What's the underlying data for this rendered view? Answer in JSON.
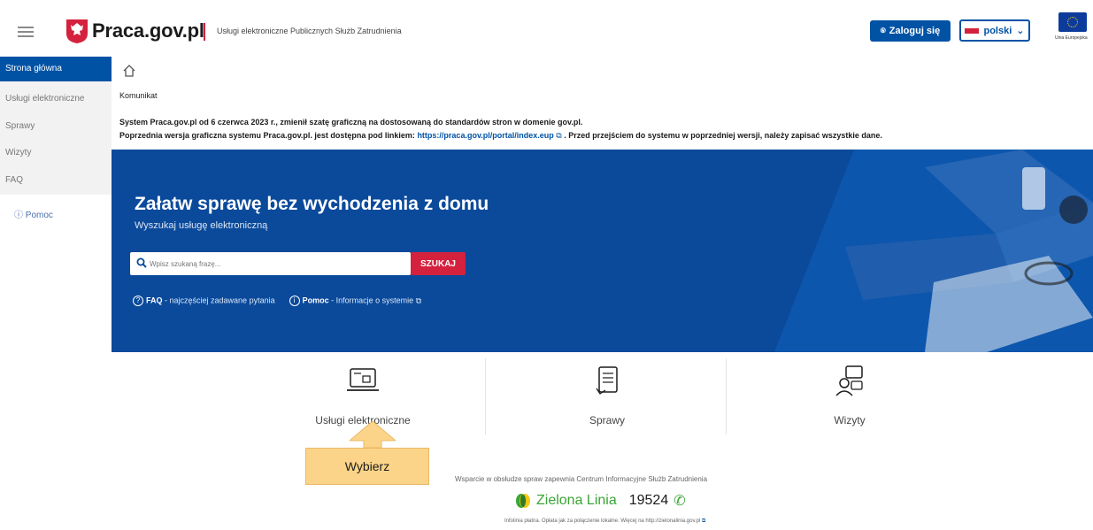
{
  "header": {
    "brand": "Praca.gov.pl",
    "subtitle": "Usługi elektroniczne Publicznych Służb Zatrudnienia",
    "login_label": "Zaloguj się",
    "lang_label": "polski",
    "eu_label": "Unia Europejska"
  },
  "sidebar": {
    "items": [
      {
        "label": "Strona główna"
      },
      {
        "label": "Usługi elektroniczne"
      },
      {
        "label": "Sprawy"
      },
      {
        "label": "Wizyty"
      },
      {
        "label": "FAQ"
      }
    ],
    "help_label": "Pomoc"
  },
  "notice": {
    "title": "Komunikat",
    "line1": "System Praca.gov.pl od 6 czerwca 2023 r., zmienił szatę graficzną na dostosowaną do standardów stron w domenie gov.pl.",
    "line2_pre": "Poprzednia wersja graficzna systemu Praca.gov.pl. jest dostępna pod linkiem: ",
    "line2_link": "https://praca.gov.pl/portal/index.eup",
    "line2_post": " . Przed przejściem do systemu w poprzedniej wersji, należy zapisać wszystkie dane."
  },
  "hero": {
    "title": "Załatw sprawę bez wychodzenia z domu",
    "subtitle": "Wyszukaj usługę elektroniczną",
    "search_placeholder": "Wpisz szukaną frazę...",
    "search_button": "SZUKAJ",
    "faq_bold": "FAQ",
    "faq_text": " - najczęściej zadawane pytania",
    "help_bold": "Pomoc",
    "help_text": " - Informacje o systemie"
  },
  "tiles": [
    {
      "label": "Usługi elektroniczne"
    },
    {
      "label": "Sprawy"
    },
    {
      "label": "Wizyty"
    }
  ],
  "callout": {
    "label": "Wybierz"
  },
  "support": {
    "text": "Wsparcie w obsłudze spraw zapewnia Centrum Informacyjne Służb Zatrudnienia",
    "line_name": "Zielona Linia",
    "line_number": "19524",
    "small": "Infolinia płatna. Opłata jak za połączenie lokalne. Więcej na http://zielonalinia.gov.pl"
  },
  "colors": {
    "primary": "#0052a5",
    "hero_bg": "#0b4a9b",
    "accent_red": "#d4213d",
    "green": "#3aa535",
    "callout": "#fcd489"
  }
}
